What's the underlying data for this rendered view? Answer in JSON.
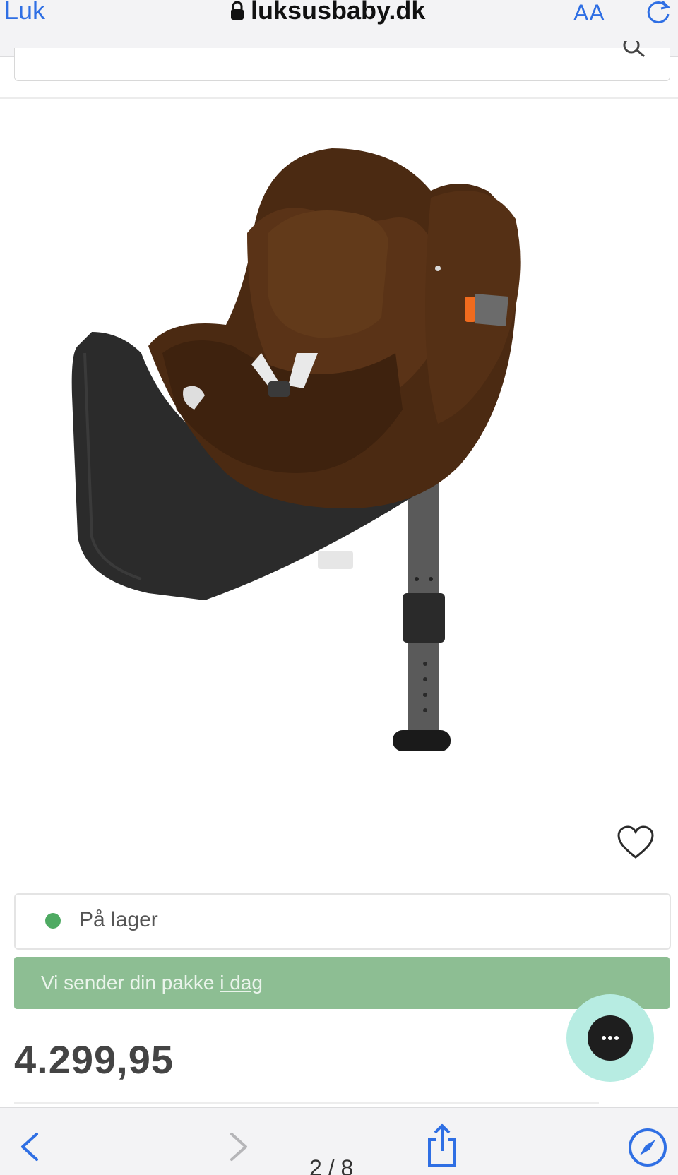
{
  "browser": {
    "close_label": "Luk",
    "url": "luksusbaby.dk",
    "text_size_label": "AA"
  },
  "product": {
    "stock_status": "På lager",
    "shipping_text": "Vi sender din pakke ",
    "shipping_link": "i dag",
    "price": "4.299,95"
  },
  "overlay": {
    "page_counter": "2 / 8"
  },
  "colors": {
    "accent_blue": "#2f6fe4",
    "stock_green": "#4eaa62",
    "banner_green": "#8dbe93",
    "chat_teal": "#b7ece2"
  },
  "icons": [
    "lock-icon",
    "reload-icon",
    "search-icon",
    "wishlist-heart-icon",
    "chat-icon",
    "back-icon",
    "forward-icon",
    "share-icon",
    "compass-icon"
  ]
}
